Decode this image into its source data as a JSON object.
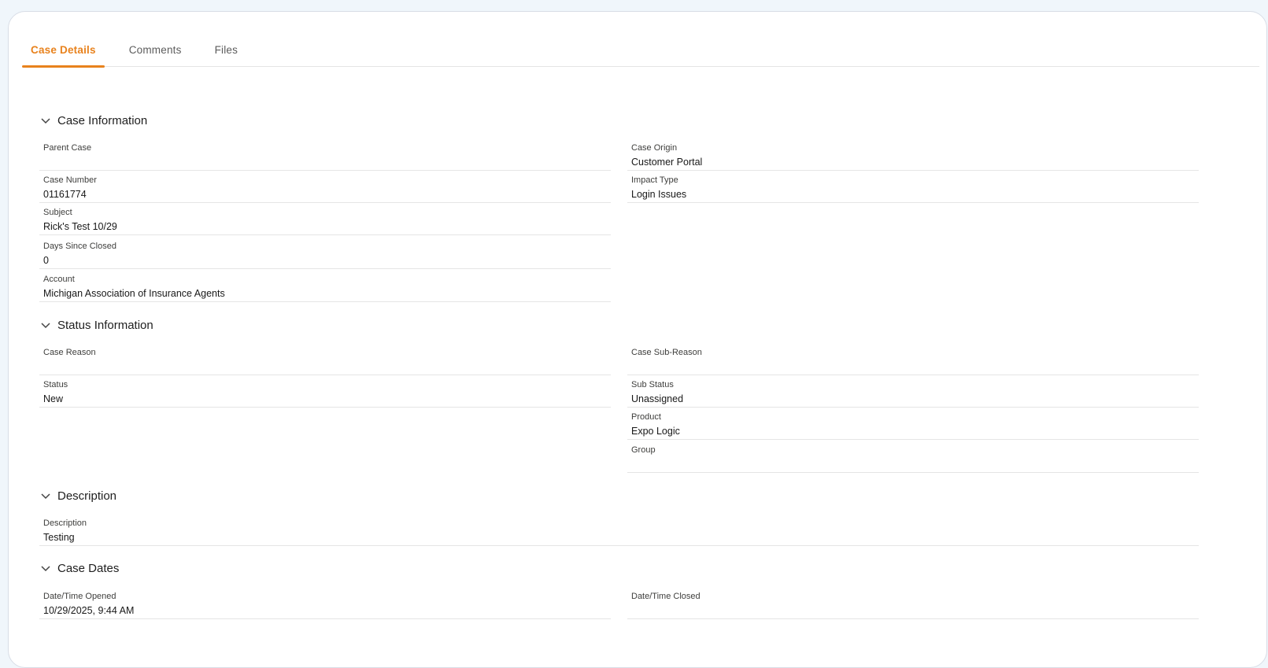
{
  "tabs": [
    {
      "label": "Case Details",
      "active": true
    },
    {
      "label": "Comments",
      "active": false
    },
    {
      "label": "Files",
      "active": false
    }
  ],
  "sections": {
    "case_information": {
      "title": "Case Information",
      "parent_case": {
        "label": "Parent Case",
        "value": ""
      },
      "case_origin": {
        "label": "Case Origin",
        "value": "Customer Portal"
      },
      "case_number": {
        "label": "Case Number",
        "value": "01161774"
      },
      "impact_type": {
        "label": "Impact Type",
        "value": "Login Issues"
      },
      "subject": {
        "label": "Subject",
        "value": "Rick's Test 10/29"
      },
      "days_since_closed": {
        "label": "Days Since Closed",
        "value": "0"
      },
      "account": {
        "label": "Account",
        "value": "Michigan Association of Insurance Agents"
      }
    },
    "status_information": {
      "title": "Status Information",
      "case_reason": {
        "label": "Case Reason",
        "value": ""
      },
      "case_sub_reason": {
        "label": "Case Sub-Reason",
        "value": ""
      },
      "status": {
        "label": "Status",
        "value": "New"
      },
      "sub_status": {
        "label": "Sub Status",
        "value": "Unassigned"
      },
      "product": {
        "label": "Product",
        "value": "Expo Logic"
      },
      "group": {
        "label": "Group",
        "value": ""
      }
    },
    "description": {
      "title": "Description",
      "description": {
        "label": "Description",
        "value": "Testing"
      }
    },
    "case_dates": {
      "title": "Case Dates",
      "opened": {
        "label": "Date/Time Opened",
        "value": "10/29/2025, 9:44 AM"
      },
      "closed": {
        "label": "Date/Time Closed",
        "value": ""
      }
    }
  },
  "colors": {
    "accent": "#e8821d",
    "divider": "#e5e5e5"
  },
  "icons": {
    "section_toggle": "chevron-down-icon"
  }
}
